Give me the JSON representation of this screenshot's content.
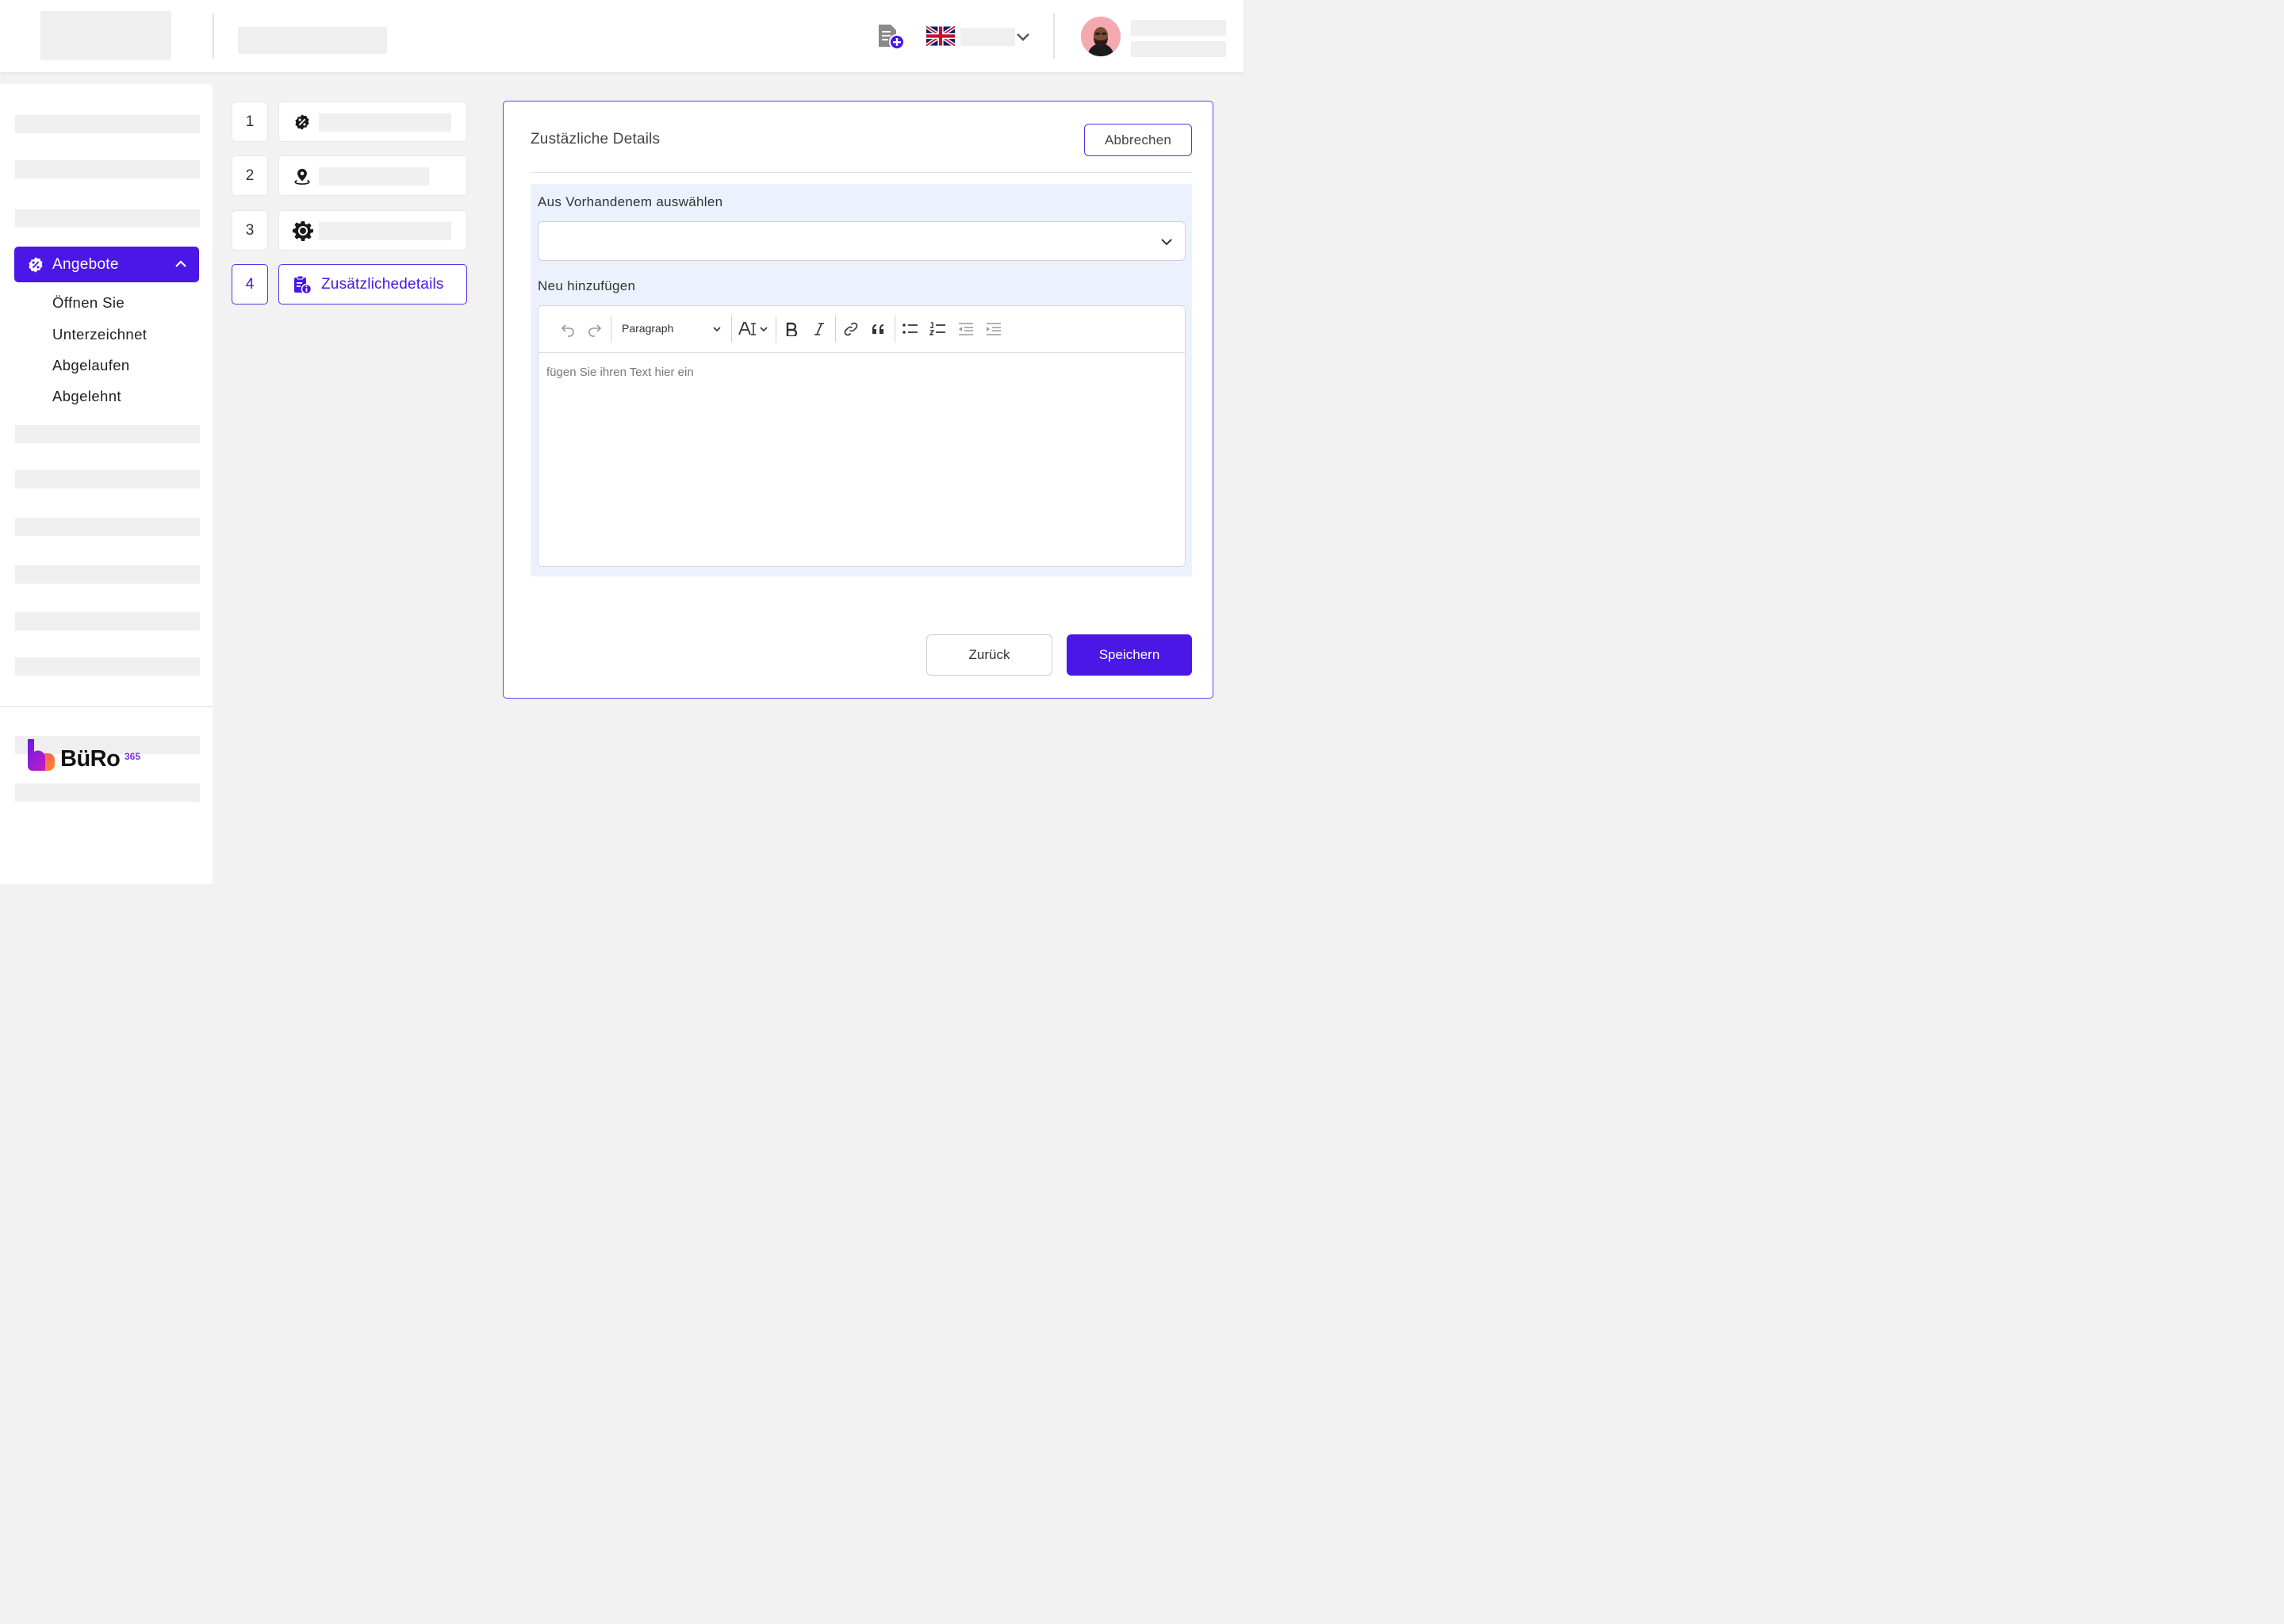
{
  "colors": {
    "accent": "#4a17e6",
    "section_bg": "#ebf2fd",
    "placeholder": "#efefef"
  },
  "header": {
    "new_document_icon": "file-plus-icon",
    "language_flag": "uk-flag-icon",
    "language_chevron": "chevron-down-icon"
  },
  "sidebar": {
    "active_item": {
      "label": "Angebote",
      "icon": "percent-badge-icon"
    },
    "submenu": [
      "Öffnen Sie",
      "Unterzeichnet",
      "Abgelaufen",
      "Abgelehnt"
    ],
    "logo": {
      "text": "BüRo",
      "sup": "365"
    }
  },
  "stepper": {
    "steps": [
      {
        "number": "1",
        "icon": "percent-badge-icon"
      },
      {
        "number": "2",
        "icon": "map-pin-icon"
      },
      {
        "number": "3",
        "icon": "gear-icon"
      },
      {
        "number": "4",
        "icon": "clipboard-info-icon",
        "label": "Zusätzlichedetails",
        "active": true
      }
    ]
  },
  "panel": {
    "title": "Zustäzliche Details",
    "cancel_label": "Abbrechen",
    "select_label": "Aus Vorhandenem auswählen",
    "select_value": "",
    "new_label": "Neu hinzufügen",
    "editor": {
      "block_format": "Paragraph",
      "placeholder": "fügen Sie ihren Text hier ein"
    },
    "back_label": "Zurück",
    "save_label": "Speichern"
  }
}
